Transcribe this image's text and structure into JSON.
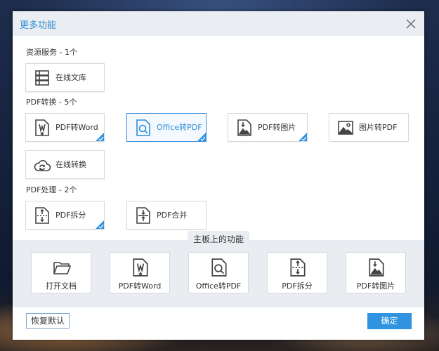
{
  "dialog": {
    "title": "更多功能"
  },
  "sections": {
    "resource": "资源服务 - 1个",
    "convert": "PDF转换 - 5个",
    "process": "PDF处理 - 2个"
  },
  "resource_items": [
    {
      "label": "在线文库",
      "icon": "library-stack-icon"
    }
  ],
  "convert_items": [
    {
      "label": "PDF转Word",
      "icon": "pdf-to-word-icon",
      "added": true
    },
    {
      "label": "Office转PDF",
      "icon": "office-to-pdf-icon",
      "added": true,
      "selected": true
    },
    {
      "label": "PDF转图片",
      "icon": "pdf-to-image-icon",
      "added": true
    },
    {
      "label": "图片转PDF",
      "icon": "image-to-pdf-icon",
      "added": false
    },
    {
      "label": "在线转换",
      "icon": "cloud-convert-icon",
      "added": false
    }
  ],
  "process_items": [
    {
      "label": "PDF拆分",
      "icon": "pdf-split-icon",
      "added": true
    },
    {
      "label": "PDF合并",
      "icon": "pdf-merge-icon",
      "added": false
    }
  ],
  "main_panel": {
    "title": "主板上的功能",
    "items": [
      {
        "label": "打开文档",
        "icon": "folder-open-icon"
      },
      {
        "label": "PDF转Word",
        "icon": "pdf-to-word-icon"
      },
      {
        "label": "Office转PDF",
        "icon": "office-to-pdf-icon"
      },
      {
        "label": "PDF拆分",
        "icon": "pdf-split-icon"
      },
      {
        "label": "PDF转图片",
        "icon": "pdf-to-image-icon"
      }
    ]
  },
  "buttons": {
    "restore": "恢复默认",
    "ok": "确定"
  },
  "colors": {
    "accent": "#2f93e0",
    "title_text": "#2f8ed8",
    "panel_bg": "#e9ecf0"
  }
}
